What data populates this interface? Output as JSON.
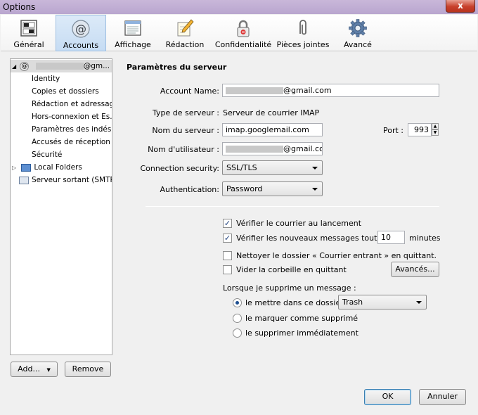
{
  "window": {
    "title": "Options",
    "close": "x"
  },
  "toolbar": {
    "items": [
      {
        "label": "Général"
      },
      {
        "label": "Accounts"
      },
      {
        "label": "Affichage"
      },
      {
        "label": "Rédaction"
      },
      {
        "label": "Confidentialité"
      },
      {
        "label": "Pièces jointes"
      },
      {
        "label": "Avancé"
      }
    ],
    "active": "Accounts"
  },
  "tree": {
    "account_suffix": "@gm...",
    "items": [
      "Identity",
      "Copies et dossiers",
      "Rédaction et adressage",
      "Hors-connexion et Es...",
      "Paramètres des indésir...",
      "Accusés de réception",
      "Sécurité",
      "Local Folders",
      "Serveur sortant (SMTP)"
    ]
  },
  "left_buttons": {
    "add": "Add...",
    "remove": "Remove"
  },
  "server": {
    "heading": "Paramètres du serveur",
    "account_name_label": "Account Name:",
    "account_name_value": "@gmail.com",
    "server_type_label": "Type de serveur :",
    "server_type_value": "Serveur de courrier IMAP",
    "server_name_label": "Nom du serveur :",
    "server_name_value": "imap.googlemail.com",
    "port_label": "Port :",
    "port_value": "993",
    "username_label": "Nom d'utilisateur :",
    "username_value": "@gmail.cor",
    "security_label": "Connection security:",
    "security_value": "SSL/TLS",
    "auth_label": "Authentication:",
    "auth_value": "Password"
  },
  "options": {
    "check_on_startup": {
      "label": "Vérifier le courrier au lancement",
      "checked": true
    },
    "check_every": {
      "label": "Vérifier les nouveaux messages toutes les",
      "value": "10",
      "unit": "minutes",
      "checked": true
    },
    "clean_inbox": {
      "label": "Nettoyer le dossier « Courrier entrant » en quittant.",
      "checked": false
    },
    "empty_trash": {
      "label": "Vider la corbeille en quittant",
      "checked": false
    },
    "advanced_button": "Avancés...",
    "delete_heading": "Lorsque je supprime un message :",
    "delete_move": {
      "label": "le mettre dans ce dossier :",
      "selected": true
    },
    "delete_folder": "Trash",
    "delete_mark": {
      "label": "le marquer comme supprimé",
      "selected": false
    },
    "delete_now": {
      "label": "le supprimer immédiatement",
      "selected": false
    }
  },
  "footer": {
    "ok": "OK",
    "cancel": "Annuler"
  }
}
